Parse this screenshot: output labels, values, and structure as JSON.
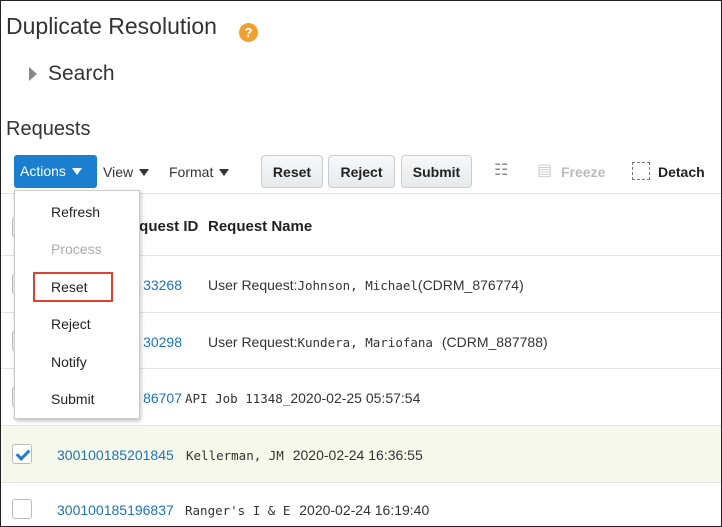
{
  "page": {
    "title": "Duplicate Resolution",
    "help_icon": "help-icon",
    "search_label": "Search",
    "section_title": "Requests"
  },
  "toolbar": {
    "actions": "Actions",
    "view": "View",
    "format": "Format",
    "reset": "Reset",
    "reject": "Reject",
    "submit": "Submit",
    "freeze": "Freeze",
    "detach": "Detach"
  },
  "table": {
    "headers": {
      "id": "Request ID",
      "name": "Request Name"
    },
    "rows": [
      {
        "id": "33268",
        "prefix": "User Request:",
        "name": "Johnson, Michael",
        "code": "(CDRM_876774)",
        "checked": false
      },
      {
        "id": "30298",
        "prefix": "User Request:",
        "name": "Kundera, Mariofana",
        "code": "(CDRM_887788)",
        "checked": false
      },
      {
        "id": "86707",
        "name": "API Job 11348_",
        "date": "2020-02-25 05:57:54",
        "checked": false
      },
      {
        "id": "300100185201845",
        "name": "Kellerman, JM",
        "date": "2020-02-24 16:36:55",
        "checked": true
      },
      {
        "id": "300100185196837",
        "name": "Ranger's I & E",
        "date": "2020-02-24 16:19:40",
        "checked": false
      }
    ]
  },
  "menu": {
    "items": [
      {
        "label": "Refresh",
        "enabled": true
      },
      {
        "label": "Process",
        "enabled": false
      },
      {
        "label": "Reset",
        "enabled": true,
        "highlighted": true
      },
      {
        "label": "Reject",
        "enabled": true
      },
      {
        "label": "Notify",
        "enabled": true
      },
      {
        "label": "Submit",
        "enabled": true
      }
    ]
  },
  "colors": {
    "accent": "#1a7fcf",
    "link": "#1f72b8",
    "highlight_box": "#e2412e",
    "help": "#f0a030",
    "selected_row": "#f7f8ec"
  }
}
